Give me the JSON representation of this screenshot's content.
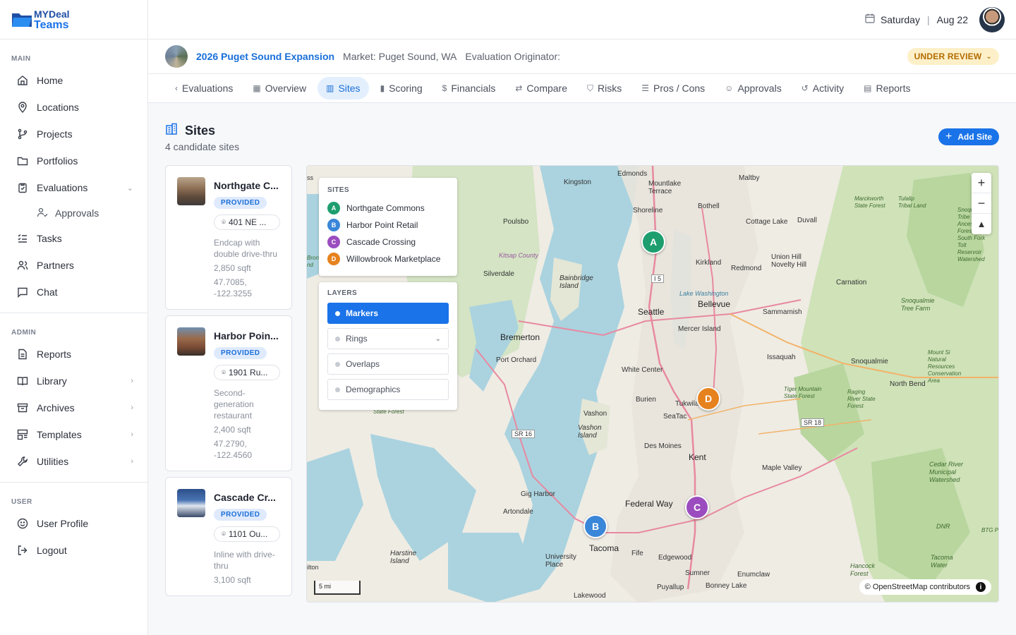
{
  "brand": {
    "line1": "MYDeal",
    "line2": "Teams"
  },
  "sidebar": {
    "main_label": "MAIN",
    "main_items": [
      {
        "label": "Home",
        "icon": "home-icon"
      },
      {
        "label": "Locations",
        "icon": "map-pin-icon"
      },
      {
        "label": "Projects",
        "icon": "branch-icon"
      },
      {
        "label": "Portfolios",
        "icon": "folder-icon"
      },
      {
        "label": "Evaluations",
        "icon": "clipboard-icon"
      }
    ],
    "evaluations_sub": "Approvals",
    "main_items2": [
      {
        "label": "Tasks",
        "icon": "list-check-icon"
      },
      {
        "label": "Partners",
        "icon": "users-icon"
      },
      {
        "label": "Chat",
        "icon": "chat-icon"
      }
    ],
    "admin_label": "ADMIN",
    "admin_items": [
      {
        "label": "Reports",
        "icon": "document-icon"
      },
      {
        "label": "Library",
        "icon": "book-icon"
      },
      {
        "label": "Archives",
        "icon": "archive-icon"
      },
      {
        "label": "Templates",
        "icon": "template-icon"
      },
      {
        "label": "Utilities",
        "icon": "wrench-icon"
      }
    ],
    "user_label": "USER",
    "user_items": [
      {
        "label": "User Profile",
        "icon": "smile-icon"
      },
      {
        "label": "Logout",
        "icon": "logout-icon"
      }
    ]
  },
  "topbar": {
    "day": "Saturday",
    "date": "Aug 22"
  },
  "project": {
    "name": "2026 Puget Sound Expansion",
    "market": "Market: Puget Sound, WA",
    "originator": "Evaluation Originator:",
    "status": "UNDER REVIEW"
  },
  "tabs": [
    "Evaluations",
    "Overview",
    "Sites",
    "Scoring",
    "Financials",
    "Compare",
    "Risks",
    "Pros / Cons",
    "Approvals",
    "Activity",
    "Reports"
  ],
  "page": {
    "title": "Sites",
    "subtitle": "4 candidate sites",
    "add_label": "Add Site"
  },
  "sites": [
    {
      "name": "Northgate C...",
      "badge": "PROVIDED",
      "address": "401 NE ...",
      "desc": "Endcap with double drive-thru",
      "sqft": "2,850 sqft",
      "coords": "47.7085, -122.3255"
    },
    {
      "name": "Harbor Poin...",
      "badge": "PROVIDED",
      "address": "1901 Ru...",
      "desc": "Second-generation restaurant",
      "sqft": "2,400 sqft",
      "coords": "47.2790, -122.4560"
    },
    {
      "name": "Cascade Cr...",
      "badge": "PROVIDED",
      "address": "1101 Ou...",
      "desc": "Inline with drive-thru",
      "sqft": "3,100 sqft",
      "coords": ""
    }
  ],
  "legend": {
    "title": "SITES",
    "items": [
      {
        "letter": "A",
        "name": "Northgate Commons",
        "color": "#1e9e6f"
      },
      {
        "letter": "B",
        "name": "Harbor Point Retail",
        "color": "#3a86d8"
      },
      {
        "letter": "C",
        "name": "Cascade Crossing",
        "color": "#9b4dbf"
      },
      {
        "letter": "D",
        "name": "Willowbrook Marketplace",
        "color": "#e6821e"
      }
    ]
  },
  "layers": {
    "title": "LAYERS",
    "items": [
      "Markers",
      "Rings",
      "Overlaps",
      "Demographics"
    ]
  },
  "map": {
    "scale": "5 mi",
    "attribution": "© OpenStreetMap contributors",
    "labels": [
      "Edmonds",
      "Kingston",
      "Mountlake Terrace",
      "Maltby",
      "Shoreline",
      "Bothell",
      "Poulsbo",
      "Cottage Lake",
      "Duvall",
      "Kirkland",
      "Redmond",
      "Union Hill Novelty Hill",
      "Silverdale",
      "Bainbridge Island",
      "Seattle",
      "Bellevue",
      "Sammamish",
      "Carnation",
      "Bremerton",
      "Mercer Island",
      "Issaquah",
      "Snoqualmie",
      "Port Orchard",
      "White Center",
      "North Bend",
      "Burien",
      "Tukwila",
      "SeaTac",
      "Vashon",
      "Vashon Island",
      "Des Moines",
      "Kent",
      "Maple Valley",
      "Gig Harbor",
      "Federal Way",
      "Artondale",
      "Tacoma",
      "University Place",
      "Fife",
      "Edgewood",
      "Sumner",
      "Puyallup",
      "Bonney Lake",
      "Enumclaw",
      "Lakewood",
      "Harstine Island",
      "I 5",
      "SR 16",
      "SR 18",
      "Lake Washington",
      "Kitsap County",
      "Snoqualmie Tree Farm",
      "Tiger Mountain State Forest",
      "Raging River State Forest",
      "Cedar River Municipal Watershed",
      "Hancock Forest",
      "Snoqualmie Tribe Ancestral Forest",
      "South Fork Tolt Reservoir Watershed",
      "Marckworth State Forest",
      "Tulalip Tribal Land",
      "Mount Si Natural Resources Conservation Area",
      "DNR",
      "Tacoma Water",
      "BTG Pa",
      "Bron nd",
      "ss",
      "ilton",
      "State Forest"
    ]
  }
}
